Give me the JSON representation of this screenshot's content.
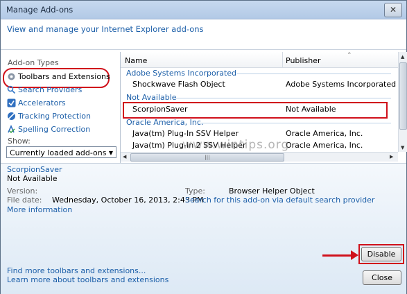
{
  "window": {
    "title": "Manage Add-ons",
    "close_label": "✕",
    "header_link": "View and manage your Internet Explorer add-ons"
  },
  "sidebar": {
    "section_label": "Add-on Types",
    "items": [
      {
        "label": "Toolbars and Extensions",
        "icon": "gear-icon"
      },
      {
        "label": "Search Providers",
        "icon": "search-icon"
      },
      {
        "label": "Accelerators",
        "icon": "accelerator-icon"
      },
      {
        "label": "Tracking Protection",
        "icon": "tracking-protection-icon"
      },
      {
        "label": "Spelling Correction",
        "icon": "spelling-icon"
      }
    ],
    "show_label": "Show:",
    "show_value": "Currently loaded add-ons"
  },
  "list": {
    "columns": [
      "Name",
      "Publisher"
    ],
    "groups": [
      {
        "name": "Adobe Systems Incorporated",
        "rows": [
          {
            "name": "Shockwave Flash Object",
            "publisher": "Adobe Systems Incorporated"
          }
        ]
      },
      {
        "name": "Not Available",
        "rows": [
          {
            "name": "ScorpionSaver",
            "publisher": "Not Available"
          }
        ]
      },
      {
        "name": "Oracle America, Inc.",
        "rows": [
          {
            "name": "Java(tm) Plug-In SSV Helper",
            "publisher": "Oracle America, Inc."
          },
          {
            "name": "Java(tm) Plug-In 2 SSV Helper",
            "publisher": "Oracle America, Inc."
          }
        ]
      }
    ]
  },
  "details": {
    "name": "ScorpionSaver",
    "publisher": "Not Available",
    "version_label": "Version:",
    "version_value": "",
    "filedate_label": "File date:",
    "filedate_value": "Wednesday, October 16, 2013, 2:43 PM",
    "more_info": "More information",
    "type_label": "Type:",
    "type_value": "Browser Helper Object",
    "search_link": "Search for this add-on via default search provider",
    "find_more": "Find more toolbars and extensions...",
    "learn_more": "Learn more about toolbars and extensions",
    "disable_label": "Disable",
    "close_label": "Close"
  },
  "watermark": "www.wintips.org",
  "colors": {
    "accent_red": "#d0101b",
    "link_blue": "#1b5ea8"
  }
}
